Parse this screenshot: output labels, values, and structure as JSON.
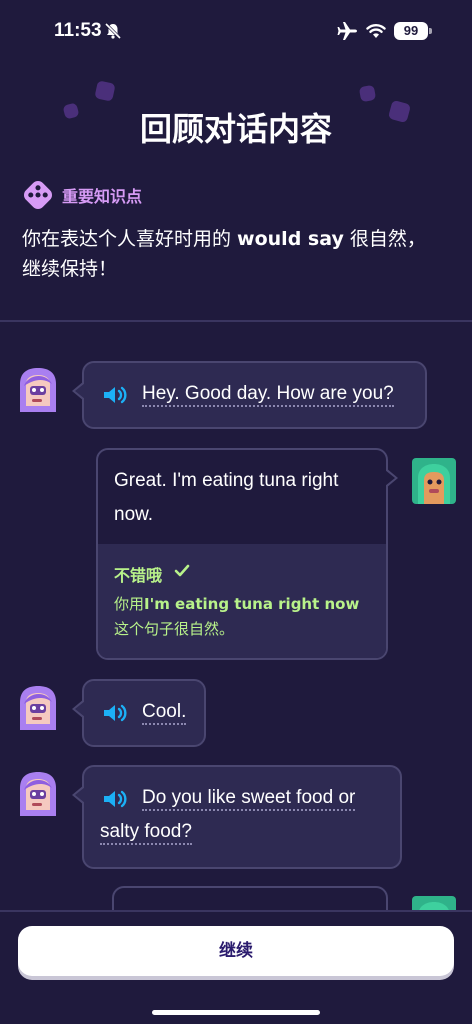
{
  "status": {
    "time": "11:53",
    "battery": "99"
  },
  "page": {
    "title": "回顾对话内容"
  },
  "tip": {
    "label": "重要知识点",
    "text_pre": "你在表达个人喜好时用的 ",
    "text_bold": "would say",
    "text_post": " 很自然，继续保持！"
  },
  "messages": [
    {
      "speaker": "lily",
      "text": "Hey. Good day. How are you?"
    },
    {
      "speaker": "user",
      "text": "Great. I'm eating tuna right now."
    },
    {
      "speaker": "lily",
      "text": "Cool."
    },
    {
      "speaker": "lily",
      "text": "Do you like sweet food or salty food?"
    }
  ],
  "feedback": {
    "title": "不错哦",
    "text_pre": "你用",
    "text_bold": "I'm eating tuna right now",
    "text_post": " 这个句子很自然。"
  },
  "footer": {
    "continue_label": "继续"
  },
  "colors": {
    "background": "#1f1a3d",
    "accent_purple": "#d69bf5",
    "feedback_green": "#b8f28a",
    "speaker_blue": "#1cb0f6"
  }
}
